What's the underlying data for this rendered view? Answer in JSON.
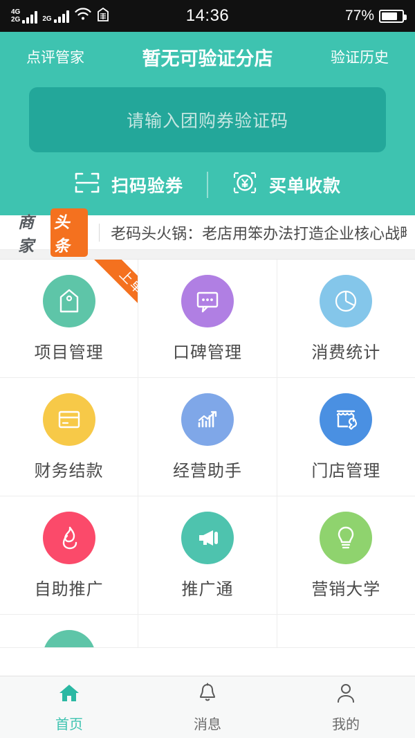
{
  "status_bar": {
    "net_primary": "4G",
    "net_secondary": "2G",
    "sim2_label": "2G",
    "wifi_icon": "wifi-icon",
    "extra_icon": "sdcard-icon",
    "time": "14:36",
    "battery_percent": "77%",
    "battery_level": 77
  },
  "header": {
    "left_label": "点评管家",
    "title": "暂无可验证分店",
    "right_label": "验证历史",
    "code_input": {
      "value": "",
      "placeholder": "请输入团购券验证码"
    },
    "actions": [
      {
        "label": "扫码验券",
        "icon": "scan-code-icon"
      },
      {
        "label": "买单收款",
        "icon": "yuan-scan-icon"
      }
    ],
    "bg_color": "#3ec3b0",
    "input_bg_color": "#23a79a"
  },
  "news": {
    "logo_word1": "商家",
    "logo_word2": "头条",
    "logo_badge_color": "#f4711f",
    "headline": "老码头火锅：老店用笨办法打造企业核心战略"
  },
  "grid": {
    "rows": [
      [
        {
          "label": "项目管理",
          "icon": "tag-icon",
          "color": "#5ec5a8",
          "badge": "上单"
        },
        {
          "label": "口碑管理",
          "icon": "chat-bubble-icon",
          "color": "#b07fe3",
          "badge": ""
        },
        {
          "label": "消费统计",
          "icon": "pie-chart-icon",
          "color": "#84c6ea",
          "badge": ""
        }
      ],
      [
        {
          "label": "财务结款",
          "icon": "credit-card-icon",
          "color": "#f7c948",
          "badge": ""
        },
        {
          "label": "经营助手",
          "icon": "bar-chart-icon",
          "color": "#7fa7e8",
          "badge": ""
        },
        {
          "label": "门店管理",
          "icon": "shop-wrench-icon",
          "color": "#4a90e2",
          "badge": ""
        }
      ],
      [
        {
          "label": "自助推广",
          "icon": "flame-icon",
          "color": "#fb4a6a",
          "badge": ""
        },
        {
          "label": "推广通",
          "icon": "megaphone-icon",
          "color": "#4ec3ae",
          "badge": ""
        },
        {
          "label": "营销大学",
          "icon": "lightbulb-icon",
          "color": "#8fd36e",
          "badge": ""
        }
      ]
    ],
    "cut_row": [
      {
        "label": "",
        "icon": "circle-icon",
        "color": "#5ec5a8",
        "badge": ""
      },
      {
        "label": "",
        "icon": "",
        "color": "",
        "badge": ""
      },
      {
        "label": "",
        "icon": "",
        "color": "",
        "badge": ""
      }
    ]
  },
  "tabbar": {
    "items": [
      {
        "label": "首页",
        "icon": "home-icon",
        "active": true
      },
      {
        "label": "消息",
        "icon": "bell-icon",
        "active": false
      },
      {
        "label": "我的",
        "icon": "person-icon",
        "active": false
      }
    ],
    "active_color": "#3ec3b0"
  }
}
